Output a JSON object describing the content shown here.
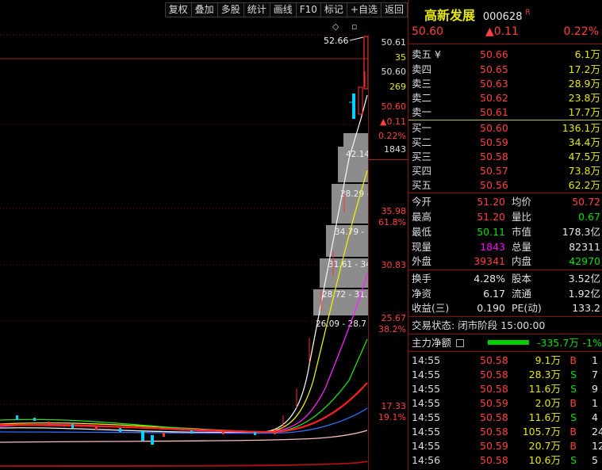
{
  "toolbar": [
    "复权",
    "叠加",
    "多股",
    "统计",
    "画线",
    "F10",
    "标记",
    "+自选",
    "返回"
  ],
  "chart": {
    "high_marker": "52.66",
    "price_labels": [
      {
        "text": "50.61",
        "color": "#e8e8e8",
        "y_price": 50.61
      },
      {
        "text": "35",
        "color": "#e8e800",
        "y_price": null
      },
      {
        "text": "50.60",
        "color": "#e8e8e8",
        "y_price": null
      },
      {
        "text": "269",
        "color": "#e8e800",
        "y_price": null
      },
      {
        "text": "50.60",
        "color": "#ff4040",
        "y_price": null
      },
      {
        "text": "▲0.11",
        "color": "#ff4040",
        "y_price": null
      },
      {
        "text": "0.22%",
        "color": "#ff4040",
        "y_price": null
      },
      {
        "text": "1843",
        "color": "#e8e8e8",
        "y_price": null
      }
    ],
    "fib_levels": [
      {
        "price": "35.98",
        "pct": "61.8%"
      },
      {
        "price": "30.83",
        "pct": ""
      },
      {
        "price": "25.67",
        "pct": "38.2%"
      },
      {
        "price": "17.33",
        "pct": "19.1%"
      }
    ],
    "volume_profile": [
      "42.14",
      "38.29 -",
      "34.79 -",
      "31.61 - 34",
      "28.72 - 31.",
      "26.09 - 28.7"
    ]
  },
  "stock": {
    "name": "高新发展",
    "code": "000628",
    "badge": "R",
    "price": "50.60",
    "change": "▲0.11",
    "pct": "0.22%"
  },
  "sell_orders": [
    {
      "label": "卖五 ¥",
      "price": "50.66",
      "volume": "6.1万"
    },
    {
      "label": "卖四",
      "price": "50.65",
      "volume": "17.2万"
    },
    {
      "label": "卖三",
      "price": "50.63",
      "volume": "28.9万"
    },
    {
      "label": "卖二",
      "price": "50.62",
      "volume": "23.8万"
    },
    {
      "label": "卖一",
      "price": "50.61",
      "volume": "17.7万"
    }
  ],
  "buy_orders": [
    {
      "label": "买一",
      "price": "50.60",
      "volume": "136.1万"
    },
    {
      "label": "买二",
      "price": "50.59",
      "volume": "34.4万"
    },
    {
      "label": "买三",
      "price": "50.58",
      "volume": "47.5万"
    },
    {
      "label": "买四",
      "price": "50.57",
      "volume": "73.8万"
    },
    {
      "label": "买五",
      "price": "50.56",
      "volume": "62.2万"
    }
  ],
  "stats": [
    {
      "l1": "今开",
      "v1": "51.20",
      "c1": "#ff4040",
      "l2": "均价",
      "v2": "50.72",
      "c2": "#ff4040"
    },
    {
      "l1": "最高",
      "v1": "51.20",
      "c1": "#ff4040",
      "l2": "量比",
      "v2": "0.67",
      "c2": "#00e000"
    },
    {
      "l1": "最低",
      "v1": "50.11",
      "c1": "#00e000",
      "l2": "市值",
      "v2": "178.3亿",
      "c2": "#e8e8e8"
    },
    {
      "l1": "现量",
      "v1": "1843",
      "c1": "#ff00ff",
      "l2": "总量",
      "v2": "82311",
      "c2": "#e8e8e8"
    },
    {
      "l1": "外盘",
      "v1": "39341",
      "c1": "#ff4040",
      "l2": "内盘",
      "v2": "42970",
      "c2": "#00e000"
    }
  ],
  "stats2": [
    {
      "l1": "换手",
      "v1": "4.28%",
      "l2": "股本",
      "v2": "3.52亿"
    },
    {
      "l1": "净资",
      "v1": "6.17",
      "l2": "流通",
      "v2": "1.92亿"
    },
    {
      "l1": "收益(三)",
      "v1": "0.190",
      "l2": "PE(动)",
      "v2": "133.2"
    }
  ],
  "trade_status": {
    "label": "交易状态:",
    "phase": "闭市阶段",
    "time": "15:00:00"
  },
  "main_flow": {
    "label": "主力净额",
    "value": "-335.7万",
    "pct": "-1%"
  },
  "ticks": [
    {
      "time": "14:55",
      "price": "50.58",
      "vol": "9.1万",
      "side": "B",
      "n": "1"
    },
    {
      "time": "14:55",
      "price": "50.58",
      "vol": "28.3万",
      "side": "S",
      "n": "7"
    },
    {
      "time": "14:55",
      "price": "50.58",
      "vol": "11.6万",
      "side": "S",
      "n": "9"
    },
    {
      "time": "14:55",
      "price": "50.59",
      "vol": "2.0万",
      "side": "B",
      "n": "1"
    },
    {
      "time": "14:55",
      "price": "50.58",
      "vol": "11.6万",
      "side": "S",
      "n": "4"
    },
    {
      "time": "14:55",
      "price": "50.58",
      "vol": "105.7万",
      "side": "B",
      "n": "24"
    },
    {
      "time": "14:55",
      "price": "50.59",
      "vol": "20.7万",
      "side": "B",
      "n": "12"
    },
    {
      "time": "14:56",
      "price": "50.58",
      "vol": "10.6万",
      "side": "S",
      "n": "5"
    }
  ]
}
